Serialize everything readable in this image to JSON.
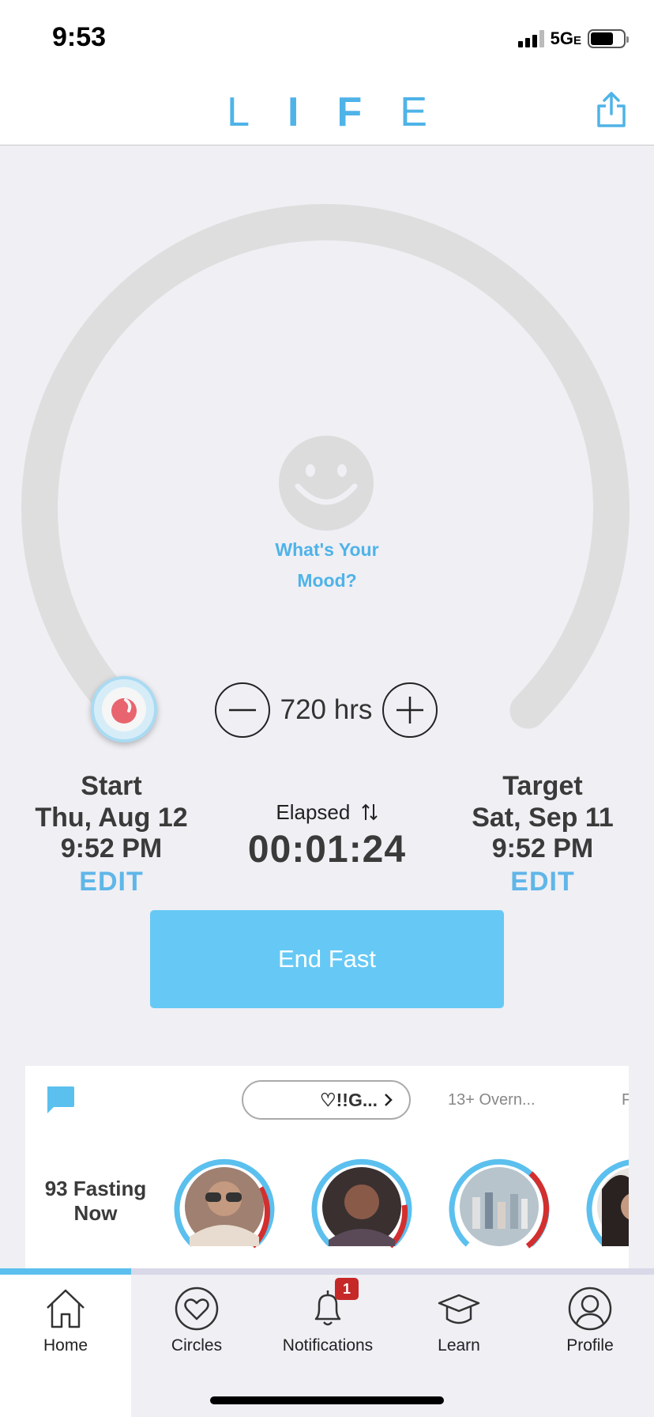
{
  "status": {
    "time": "9:53",
    "network": "5G",
    "network_suffix": "E"
  },
  "header": {
    "logo_letters": [
      "L",
      "I",
      "F",
      "E"
    ]
  },
  "dial": {
    "mood_prompt_line1": "What's Your",
    "mood_prompt_line2": "Mood?",
    "duration_value": "720 hrs"
  },
  "start": {
    "heading": "Start",
    "date": "Thu, Aug 12",
    "time": "9:52 PM",
    "edit_label": "EDIT"
  },
  "target": {
    "heading": "Target",
    "date": "Sat, Sep 11",
    "time": "9:52 PM",
    "edit_label": "EDIT"
  },
  "elapsed": {
    "label": "Elapsed",
    "value": "00:01:24"
  },
  "end_button": {
    "label": "End Fast"
  },
  "circles": {
    "active_tab": "♡!!G...",
    "tabs": [
      "13+ Overn...",
      "F"
    ],
    "fasting_now_line1": "93 Fasting",
    "fasting_now_line2": "Now",
    "avatars": [
      {
        "name": "fasting-user-1",
        "progress": 0.95
      },
      {
        "name": "fasting-user-2",
        "progress": 0.95
      },
      {
        "name": "fasting-user-3",
        "progress": 0.95
      },
      {
        "name": "fasting-user-4",
        "progress": 0.5
      }
    ]
  },
  "tabbar": {
    "items": [
      {
        "label": "Home",
        "icon": "home-icon"
      },
      {
        "label": "Circles",
        "icon": "heart-circle-icon"
      },
      {
        "label": "Notifications",
        "icon": "bell-icon",
        "badge": "1"
      },
      {
        "label": "Learn",
        "icon": "graduation-cap-icon"
      },
      {
        "label": "Profile",
        "icon": "profile-icon"
      }
    ]
  },
  "colors": {
    "accent": "#4fb3e8",
    "button": "#66c9f5",
    "badge": "#c62828",
    "ring_track": "#dedede"
  }
}
